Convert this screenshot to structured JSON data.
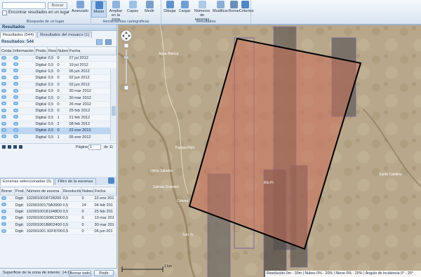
{
  "ribbon": {
    "search_button": "Buscar",
    "checkbox_label": "Encontrar resultados en un lugar",
    "advanced": "Avanzado",
    "group_search": "Búsqueda de un lugar",
    "tools": [
      {
        "label": "Mover"
      },
      {
        "label": "Ampliar en la zona"
      },
      {
        "label": "Capas"
      },
      {
        "label": "Medir"
      }
    ],
    "group_tools": "Herramientas cartográficas",
    "results_tools": [
      {
        "label": "Dibujar"
      },
      {
        "label": "Cargar"
      },
      {
        "label": "Números de escenas"
      },
      {
        "label": "Modificar"
      },
      {
        "label": "Borrar"
      },
      {
        "label": "Criterios"
      }
    ],
    "group_results": "Resultados"
  },
  "results": {
    "header": "Resultados",
    "tabs": [
      "Resultados (544)",
      "Resultados del mosaico (1)"
    ],
    "count": "Resultados: 544",
    "columns": [
      "Cesta",
      "Información",
      "Produ",
      "Resol",
      "Nubes",
      "Fecha"
    ],
    "rows": [
      [
        "Digital",
        "0,5",
        "0",
        "27 jul 2012"
      ],
      [
        "Digital",
        "0,5",
        "0",
        "19 jul 2012"
      ],
      [
        "Digital",
        "0,5",
        "0",
        "06 jun 2012"
      ],
      [
        "Digital",
        "0,5",
        "0",
        "02 jun 2012"
      ],
      [
        "Digital",
        "0,5",
        "0",
        "02 jun 2012"
      ],
      [
        "Digital",
        "0,5",
        "0",
        "30 mar 2012"
      ],
      [
        "Digital",
        "0,5",
        "0",
        "30 mar 2012"
      ],
      [
        "Digital",
        "0,5",
        "0",
        "26 mar 2012"
      ],
      [
        "Digital",
        "0,5",
        "0",
        "25 feb 2012"
      ],
      [
        "Digital",
        "0,5",
        "1",
        "21 feb 2012"
      ],
      [
        "Digital",
        "0,5",
        "2",
        "08 feb 2012"
      ],
      [
        "Digital",
        "0,5",
        "0",
        "22 ene 2012"
      ],
      [
        "Digital",
        "0,5",
        "1",
        "05 ene 2012"
      ]
    ],
    "selected_index": 11,
    "pager_label": "Página",
    "pager_value": "1",
    "pager_total": "de 11"
  },
  "selected": {
    "tabs": [
      "Escenas seleccionadas (6)",
      "Filtro de la escenas"
    ],
    "columns": [
      "Borrar",
      "Prod.",
      "Número de escena",
      "Resolución",
      "Nubes",
      "Fecha"
    ],
    "rows": [
      [
        "Digit:",
        "1020010018728200",
        "0,5",
        "0",
        "22 ene 201"
      ],
      [
        "Digit:",
        "10200100179A3900",
        "0,5",
        "14",
        "04 feb 201"
      ],
      [
        "Digit:",
        "10200100181948D0",
        "0,5",
        "0",
        "25 feb 201"
      ],
      [
        "Digit:",
        "102001001908CD00",
        "0,5",
        "0",
        "13 mar 201"
      ],
      [
        "Digit:",
        "102001001B802400",
        "0,5",
        "0",
        "30 mar 201"
      ],
      [
        "Digit:",
        "102001001 92F8700",
        "0,5",
        "0",
        "06 jun 201"
      ]
    ]
  },
  "footer": {
    "area_label": "Superficie de la zona de interés: 14.632",
    "clear_button": "Borrar todo",
    "order_button": "Pedir"
  },
  "map": {
    "labels": [
      "Agua Blanca",
      "Pampa Palo",
      "Ojitos Salados",
      "Salinas Grandes",
      "Río Pi",
      "Cobres",
      "San Ju",
      "Santa Catalina"
    ],
    "scale": "1 km",
    "status": "Resolución 0m - 30m | Nubes 0% - 20% | Nieve 0% - 20% | Ángulo de incidencia 0° - 20°"
  },
  "colors": {
    "aoi_fill": "#c8705a",
    "accent": "#2f7fd0"
  }
}
